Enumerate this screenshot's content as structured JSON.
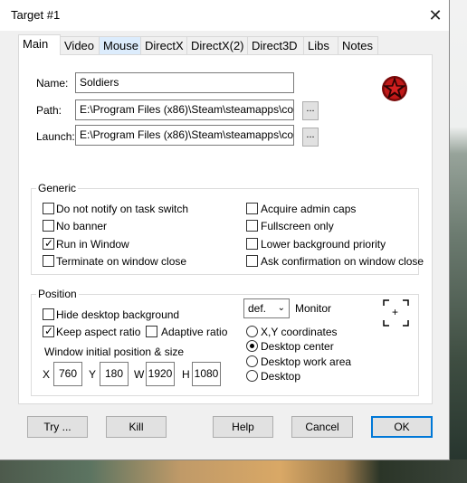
{
  "window": {
    "title": "Target #1",
    "close_glyph": "✕"
  },
  "tabs": [
    "Main",
    "Video",
    "Mouse",
    "DirectX",
    "DirectX(2)",
    "Direct3D",
    "Libs",
    "Notes"
  ],
  "main": {
    "name_label": "Name:",
    "name_value": "Soldiers",
    "path_label": "Path:",
    "path_value": "E:\\Program Files (x86)\\Steam\\steamapps\\commo",
    "launch_label": "Launch:",
    "launch_value": "E:\\Program Files (x86)\\Steam\\steamapps\\commo",
    "browse_label": "..."
  },
  "generic": {
    "title": "Generic",
    "options": [
      {
        "label": "Do not notify on task switch",
        "checked": false
      },
      {
        "label": "No banner",
        "checked": false
      },
      {
        "label": "Run in Window",
        "checked": true
      },
      {
        "label": "Terminate on window close",
        "checked": false
      },
      {
        "label": "Acquire admin caps",
        "checked": false
      },
      {
        "label": "Fullscreen only",
        "checked": false
      },
      {
        "label": "Lower background priority",
        "checked": false
      },
      {
        "label": "Ask confirmation on window close",
        "checked": false
      }
    ]
  },
  "position": {
    "title": "Position",
    "hide_desktop_bg": {
      "label": "Hide desktop background",
      "checked": false
    },
    "keep_aspect": {
      "label": "Keep aspect ratio",
      "checked": true
    },
    "adaptive": {
      "label": "Adaptive ratio",
      "checked": false
    },
    "initial_label": "Window initial position & size",
    "x_label": "X",
    "x_value": "760",
    "y_label": "Y",
    "y_value": "180",
    "w_label": "W",
    "w_value": "1920",
    "h_label": "H",
    "h_value": "1080",
    "monitor_value": "def.",
    "monitor_label": "Monitor",
    "placement": [
      {
        "label": "X,Y coordinates",
        "selected": false
      },
      {
        "label": "Desktop center",
        "selected": true
      },
      {
        "label": "Desktop work area",
        "selected": false
      },
      {
        "label": "Desktop",
        "selected": false
      }
    ],
    "crosshair_glyph": "+"
  },
  "buttons": {
    "try": "Try ...",
    "kill": "Kill",
    "help": "Help",
    "cancel": "Cancel",
    "ok": "OK"
  },
  "colors": {
    "accent": "#0078d7",
    "logo_red": "#b01212"
  }
}
